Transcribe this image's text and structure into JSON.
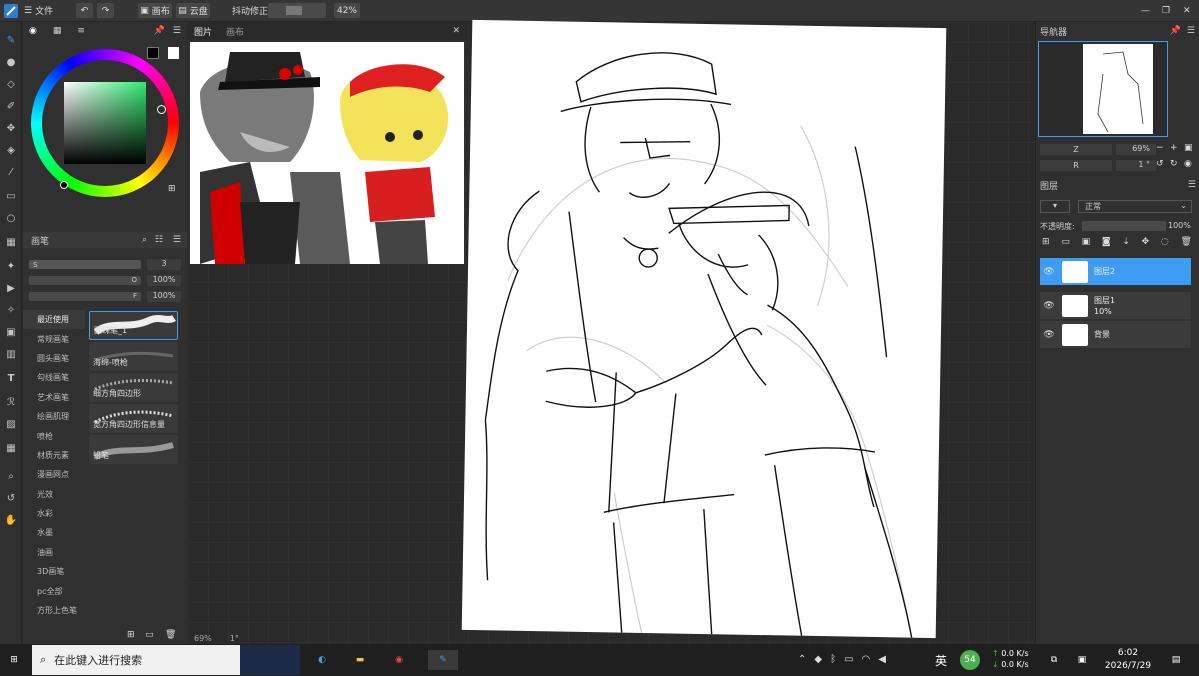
{
  "menu": {
    "file_label": "文件",
    "canvas_label": "画布",
    "cloud_label": "云盘",
    "stabilizer_label": "抖动修正",
    "zoom": "42%"
  },
  "ref": {
    "tabs": [
      "图片",
      "画布"
    ]
  },
  "brush_panel": {
    "title": "画笔",
    "size_label": "S",
    "size_value": "3",
    "opacity_label": "O",
    "opacity_value": "100%",
    "flow_label": "F",
    "flow_value": "100%",
    "categories": [
      "最近使用",
      "常规画笔",
      "圆头画笔",
      "勾线画笔",
      "艺术画笔",
      "绘画肌理",
      "喷枪",
      "材质元素",
      "漫画网点",
      "光效",
      "水彩",
      "水墨",
      "油画",
      "3D画笔",
      "pc全部",
      "方形上色笔"
    ],
    "brushes": [
      "圆珠笔_1",
      "海绵-喷枪",
      "细方角四边形",
      "宽方角四边形信息量",
      "铅笔"
    ]
  },
  "navigator": {
    "title": "导航器",
    "zoom_label": "Z",
    "zoom_value": "69%",
    "rotate_label": "R",
    "rotate_value": "1 °"
  },
  "layers": {
    "title": "图层",
    "blend_mode": "正常",
    "opacity_label": "不透明度:",
    "opacity_value": "100%",
    "items": [
      {
        "name": "图层2",
        "opacity": ""
      },
      {
        "name": "图层1",
        "opacity": "10%"
      },
      {
        "name": "背景",
        "opacity": ""
      }
    ]
  },
  "status": {
    "zoom": "69%",
    "rotation": "1°"
  },
  "taskbar": {
    "search_placeholder": "在此键入进行搜索",
    "ime": "英",
    "badge": "54",
    "net_up": "0.0",
    "net_down": "0.0",
    "net_unit": "K/s",
    "time": "6:02",
    "date": "2026/7/29"
  },
  "colors": {
    "accent": "#3d9df3",
    "panel": "#303030",
    "canvas_bg": "#2a2a2a"
  }
}
